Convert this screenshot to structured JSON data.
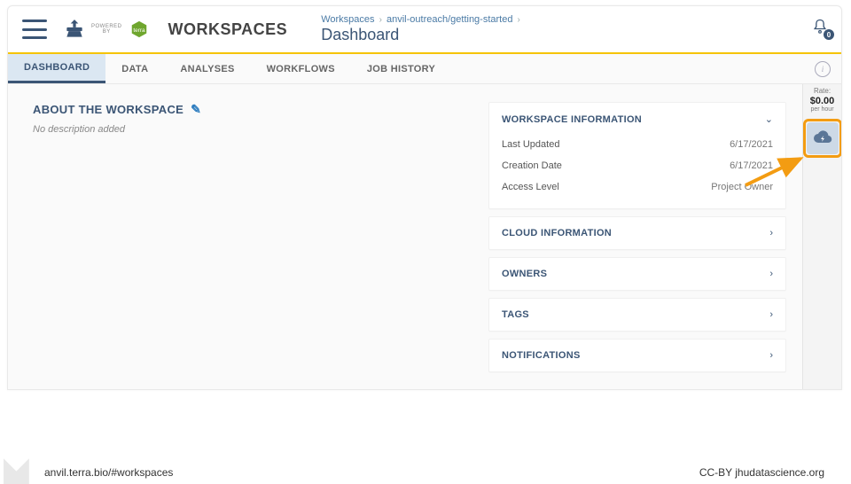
{
  "header": {
    "powered_label": "POWERED\nBY",
    "app_title": "WORKSPACES",
    "breadcrumb1": "Workspaces",
    "breadcrumb2": "anvil-outreach/getting-started",
    "page_title": "Dashboard",
    "notif_count": "0"
  },
  "tabs": [
    {
      "label": "DASHBOARD",
      "active": true
    },
    {
      "label": "DATA",
      "active": false
    },
    {
      "label": "ANALYSES",
      "active": false
    },
    {
      "label": "WORKFLOWS",
      "active": false
    },
    {
      "label": "JOB HISTORY",
      "active": false
    }
  ],
  "about": {
    "title": "ABOUT THE WORKSPACE",
    "empty": "No description added"
  },
  "panels": {
    "workspace_info": {
      "title": "WORKSPACE INFORMATION",
      "rows": [
        {
          "label": "Last Updated",
          "value": "6/17/2021"
        },
        {
          "label": "Creation Date",
          "value": "6/17/2021"
        },
        {
          "label": "Access Level",
          "value": "Project Owner"
        }
      ]
    },
    "cloud": {
      "title": "CLOUD INFORMATION"
    },
    "owners": {
      "title": "OWNERS"
    },
    "tags": {
      "title": "TAGS"
    },
    "notifications": {
      "title": "NOTIFICATIONS"
    }
  },
  "rail": {
    "rate_label": "Rate:",
    "rate_value": "$0.00",
    "rate_unit": "per hour"
  },
  "footer": {
    "url": "anvil.terra.bio/#workspaces",
    "attribution": "CC-BY  jhudatascience.org"
  }
}
